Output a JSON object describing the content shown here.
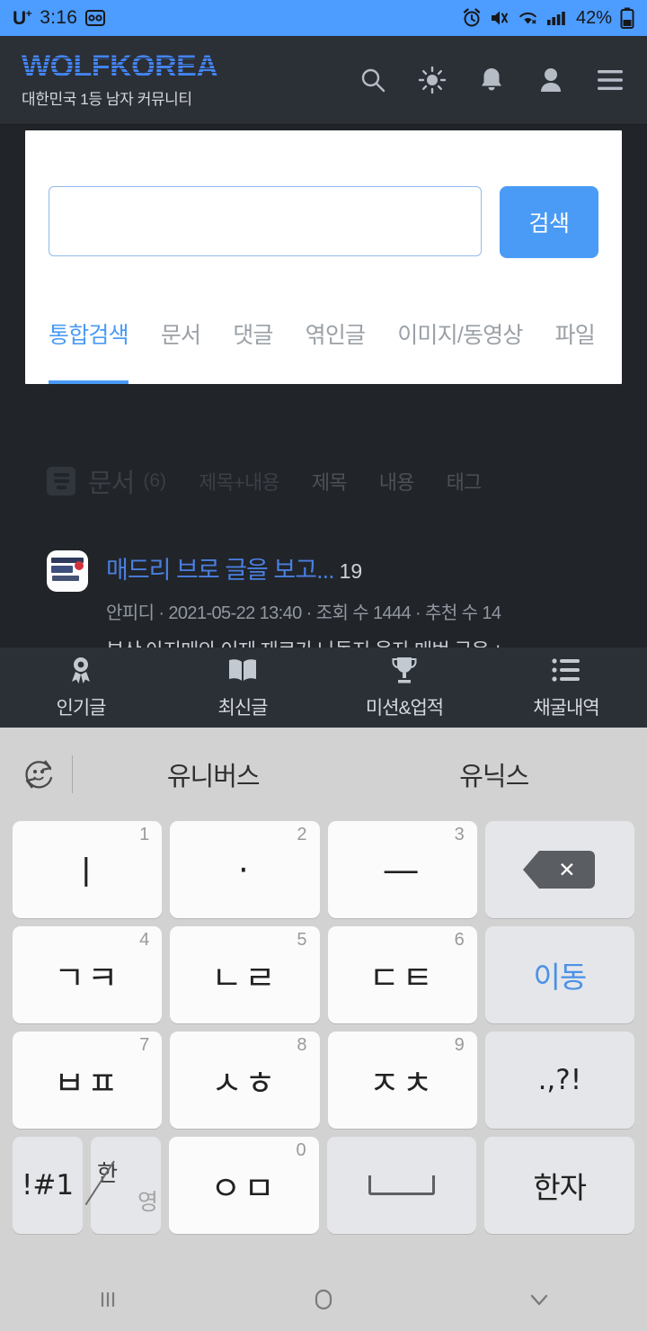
{
  "statusbar": {
    "carrier": "U",
    "carrier_sup": "+",
    "time": "3:16",
    "battery": "42%",
    "icons": [
      "voicemail-icon",
      "alarm-icon",
      "mute-icon",
      "wifi-icon",
      "signal-icon",
      "battery-icon"
    ]
  },
  "header": {
    "brand_title": "WOLFKOREA",
    "brand_sub": "대한민국 1등 남자 커뮤니티",
    "brand_color": "#4285f4",
    "icons": [
      "search-icon",
      "brightness-icon",
      "bell-icon",
      "person-icon",
      "menu-icon"
    ]
  },
  "search": {
    "value": "",
    "placeholder": "",
    "button_label": "검색",
    "button_color": "#4a9bf5",
    "tabs": [
      {
        "label": "통합검색",
        "active": true
      },
      {
        "label": "문서",
        "active": false
      },
      {
        "label": "댓글",
        "active": false
      },
      {
        "label": "엮인글",
        "active": false
      },
      {
        "label": "이미지/동영상",
        "active": false
      },
      {
        "label": "파일",
        "active": false
      }
    ]
  },
  "results": {
    "section_title": "문서",
    "section_count": "(6)",
    "filters": [
      "제목+내용",
      "제목",
      "내용",
      "태그"
    ],
    "items": [
      {
        "title": "매드리 브로 글을 보고...",
        "comments": "19",
        "meta": "안피디 · 2021-05-22 13:40 · 조회 수 1444 · 추천 수 14",
        "excerpt": "부산 아지매와 이제 재료가 나돌지 웃자 매번 군옷 ㄴ"
      }
    ]
  },
  "bottomnav": {
    "items": [
      {
        "label": "인기글",
        "icon": "award-ribbon-icon"
      },
      {
        "label": "최신글",
        "icon": "open-book-icon"
      },
      {
        "label": "미션&업적",
        "icon": "trophy-icon"
      },
      {
        "label": "채굴내역",
        "icon": "list-icon"
      }
    ]
  },
  "keyboard": {
    "suggestions": [
      "유니버스",
      "유닉스"
    ],
    "emoji_icon": "emoji-rotate-icon",
    "rows": [
      [
        {
          "main": "ㅣ",
          "num": "1",
          "type": "letter"
        },
        {
          "main": "·",
          "num": "2",
          "type": "letter"
        },
        {
          "main": "―",
          "num": "3",
          "type": "letter"
        },
        {
          "main": "",
          "num": "",
          "type": "backspace",
          "name": "backspace-key"
        }
      ],
      [
        {
          "main": "ㄱㅋ",
          "num": "4",
          "type": "letter"
        },
        {
          "main": "ㄴㄹ",
          "num": "5",
          "type": "letter"
        },
        {
          "main": "ㄷㅌ",
          "num": "6",
          "type": "letter"
        },
        {
          "main": "이동",
          "num": "",
          "type": "blue",
          "name": "go-key"
        }
      ],
      [
        {
          "main": "ㅂㅍ",
          "num": "7",
          "type": "letter"
        },
        {
          "main": "ㅅㅎ",
          "num": "8",
          "type": "letter"
        },
        {
          "main": "ㅈㅊ",
          "num": "9",
          "type": "letter"
        },
        {
          "main": ".,?!",
          "num": "",
          "type": "fn",
          "name": "punctuation-key"
        }
      ],
      [
        {
          "main": "!#1",
          "num": "",
          "type": "fn-narrow",
          "name": "symbols-key"
        },
        {
          "main": "한/영",
          "num": "",
          "type": "lang",
          "name": "language-toggle-key"
        },
        {
          "main": "ㅇㅁ",
          "num": "0",
          "type": "letter"
        },
        {
          "main": "",
          "num": "",
          "type": "space",
          "name": "space-key"
        },
        {
          "main": "한자",
          "num": "",
          "type": "fn",
          "name": "hanja-key"
        }
      ]
    ],
    "lang_primary": "한",
    "lang_secondary": "영"
  },
  "androidnav": {
    "items": [
      "recents-icon",
      "home-icon",
      "hide-keyboard-icon"
    ]
  }
}
